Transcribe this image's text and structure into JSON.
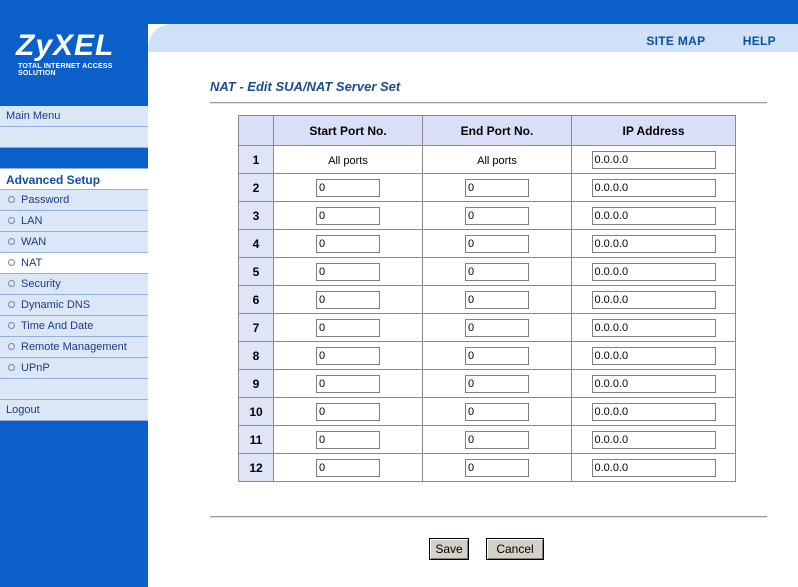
{
  "brand": {
    "name": "ZyXEL",
    "tagline": "Total Internet Access Solution"
  },
  "top_nav": {
    "site_map": "SITE MAP",
    "help": "HELP"
  },
  "sidebar": {
    "main_menu": "Main Menu",
    "advanced_setup": "Advanced Setup",
    "items": [
      "Password",
      "LAN",
      "WAN",
      "NAT",
      "Security",
      "Dynamic DNS",
      "Time And Date",
      "Remote Management",
      "UPnP"
    ],
    "active_item": "NAT",
    "logout": "Logout"
  },
  "page": {
    "title": "NAT - Edit SUA/NAT Server Set",
    "columns": [
      "",
      "Start Port No.",
      "End Port No.",
      "IP Address"
    ],
    "rows": [
      {
        "n": "1",
        "start": "All ports",
        "end": "All ports",
        "ip": "0.0.0.0"
      },
      {
        "n": "2",
        "start": "0",
        "end": "0",
        "ip": "0.0.0.0"
      },
      {
        "n": "3",
        "start": "0",
        "end": "0",
        "ip": "0.0.0.0"
      },
      {
        "n": "4",
        "start": "0",
        "end": "0",
        "ip": "0.0.0.0"
      },
      {
        "n": "5",
        "start": "0",
        "end": "0",
        "ip": "0.0.0.0"
      },
      {
        "n": "6",
        "start": "0",
        "end": "0",
        "ip": "0.0.0.0"
      },
      {
        "n": "7",
        "start": "0",
        "end": "0",
        "ip": "0.0.0.0"
      },
      {
        "n": "8",
        "start": "0",
        "end": "0",
        "ip": "0.0.0.0"
      },
      {
        "n": "9",
        "start": "0",
        "end": "0",
        "ip": "0.0.0.0"
      },
      {
        "n": "10",
        "start": "0",
        "end": "0",
        "ip": "0.0.0.0"
      },
      {
        "n": "11",
        "start": "0",
        "end": "0",
        "ip": "0.0.0.0"
      },
      {
        "n": "12",
        "start": "0",
        "end": "0",
        "ip": "0.0.0.0"
      }
    ],
    "save_label": "Save",
    "cancel_label": "Cancel"
  },
  "colors": {
    "brand_blue": "#0b5fc9",
    "menu_bg": "#dbe6f6",
    "title_text": "#1e4c8a",
    "table_header": "#d9dff6"
  }
}
